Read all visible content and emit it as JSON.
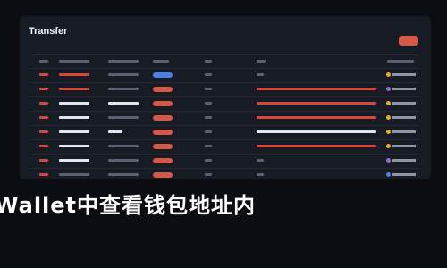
{
  "page": {
    "title": "Transfer",
    "footer": "Wallet中查看钱包地址内",
    "colors": {
      "background": "#0b0d12",
      "panel": "#171b23",
      "accent_red": "#d65745",
      "accent_blue": "#4c7fe8",
      "accent_orange": "#f1a33b",
      "text": "#f2f4f7"
    },
    "table": {
      "rows": [
        {
          "status": "blue",
          "coin_icon": "orange-coin-icon"
        },
        {
          "status": "red",
          "coin_icon": "purple-coin-icon"
        },
        {
          "status": "red",
          "coin_icon": "orange-coin-icon"
        },
        {
          "status": "red",
          "coin_icon": "orange-coin-icon"
        },
        {
          "status": "red",
          "coin_icon": "orange-coin-icon"
        },
        {
          "status": "red",
          "coin_icon": "orange-coin-icon"
        },
        {
          "status": "red",
          "coin_icon": "purple-coin-icon"
        },
        {
          "status": "red",
          "coin_icon": "blue-coin-icon"
        }
      ]
    }
  }
}
